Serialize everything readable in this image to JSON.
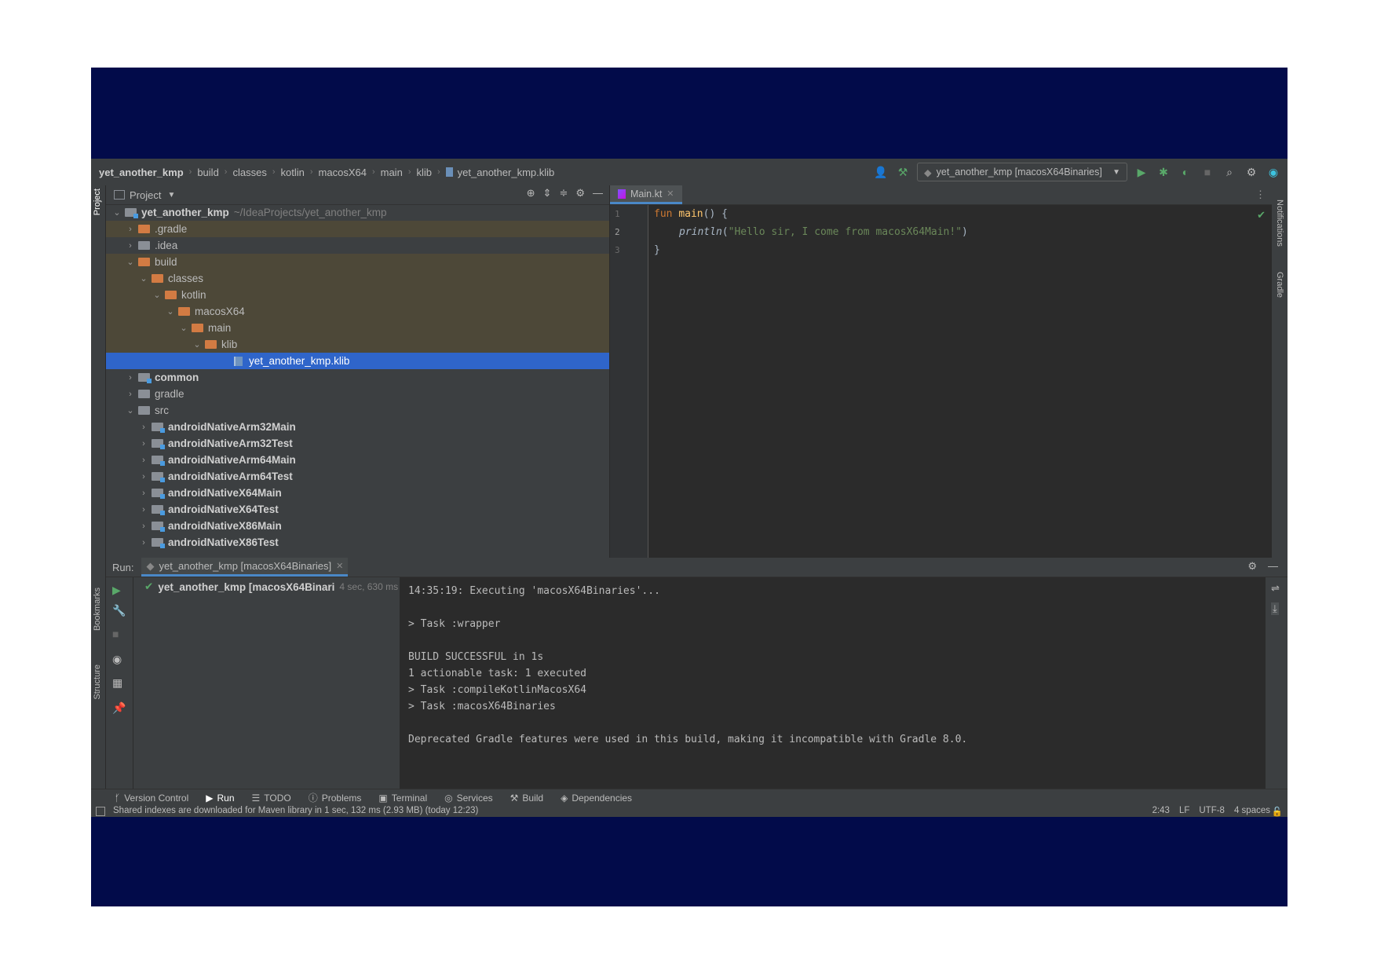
{
  "breadcrumbs": [
    "yet_another_kmp",
    "build",
    "classes",
    "kotlin",
    "macosX64",
    "main",
    "klib",
    "yet_another_kmp.klib"
  ],
  "run_config": "yet_another_kmp [macosX64Binaries]",
  "left_strip": {
    "project": "Project",
    "bookmarks": "Bookmarks",
    "structure": "Structure"
  },
  "right_strip": {
    "notifications": "Notifications",
    "gradle": "Gradle"
  },
  "project_panel": {
    "title": "Project",
    "tree": [
      {
        "label": "yet_another_kmp",
        "path": "~/IdeaProjects/yet_another_kmp"
      },
      {
        "label": ".gradle"
      },
      {
        "label": ".idea"
      },
      {
        "label": "build"
      },
      {
        "label": "classes"
      },
      {
        "label": "kotlin"
      },
      {
        "label": "macosX64"
      },
      {
        "label": "main"
      },
      {
        "label": "klib"
      },
      {
        "label": "yet_another_kmp.klib"
      },
      {
        "label": "common"
      },
      {
        "label": "gradle"
      },
      {
        "label": "src"
      },
      {
        "label": "androidNativeArm32Main"
      },
      {
        "label": "androidNativeArm32Test"
      },
      {
        "label": "androidNativeArm64Main"
      },
      {
        "label": "androidNativeArm64Test"
      },
      {
        "label": "androidNativeX64Main"
      },
      {
        "label": "androidNativeX64Test"
      },
      {
        "label": "androidNativeX86Main"
      },
      {
        "label": "androidNativeX86Test"
      }
    ]
  },
  "editor": {
    "tab": "Main.kt",
    "line_numbers": [
      "1",
      "2",
      "3"
    ],
    "code": {
      "l1_kw": "fun ",
      "l1_fn": "main",
      "l1_rest": "() {",
      "l2_call": "println",
      "l2_open": "(",
      "l2_str": "\"Hello sir, I come from macosX64Main!\"",
      "l2_close": ")",
      "l3": "}"
    }
  },
  "run": {
    "label": "Run:",
    "tab": "yet_another_kmp [macosX64Binaries]",
    "tree_item": "yet_another_kmp [macosX64Binari",
    "tree_time": "4 sec, 630 ms",
    "console": [
      "14:35:19: Executing 'macosX64Binaries'...",
      "",
      "> Task :wrapper",
      "",
      "BUILD SUCCESSFUL in 1s",
      "1 actionable task: 1 executed",
      "> Task :compileKotlinMacosX64",
      "> Task :macosX64Binaries",
      "",
      "Deprecated Gradle features were used in this build, making it incompatible with Gradle 8.0."
    ]
  },
  "bottom_tabs": [
    "Version Control",
    "Run",
    "TODO",
    "Problems",
    "Terminal",
    "Services",
    "Build",
    "Dependencies"
  ],
  "status": {
    "message": "Shared indexes are downloaded for Maven library in 1 sec, 132 ms (2.93 MB) (today 12:23)",
    "position": "2:43",
    "line_sep": "LF",
    "encoding": "UTF-8",
    "indent": "4 spaces"
  },
  "colors": {
    "selection": "#2f65ca",
    "excluded": "#4d4838",
    "accent": "#4a88c7",
    "run_green": "#59a869"
  }
}
